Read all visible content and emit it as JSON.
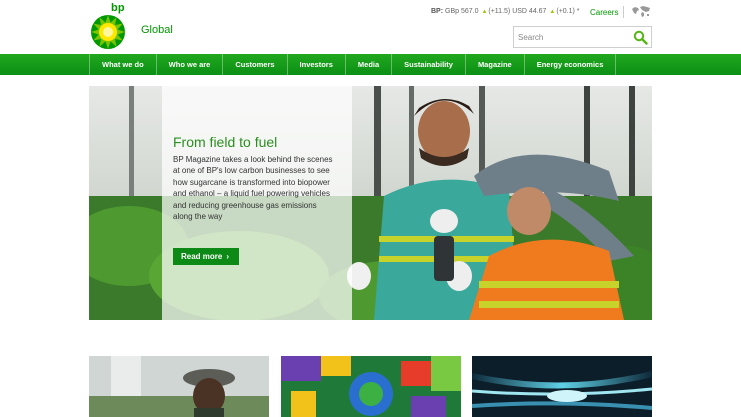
{
  "brand": {
    "name": "bp",
    "region": "Global"
  },
  "ticker": {
    "label": "BP:",
    "gbp": "GBp 567.0",
    "gbp_change": "(+11.5)",
    "usd": "USD 44.67",
    "usd_change": "(+0.1)",
    "note": "*"
  },
  "header_links": {
    "careers": "Careers"
  },
  "search": {
    "placeholder": "Search"
  },
  "nav": {
    "items": [
      "What we do",
      "Who we are",
      "Customers",
      "Investors",
      "Media",
      "Sustainability",
      "Magazine",
      "Energy economics"
    ]
  },
  "hero": {
    "title": "From field to fuel",
    "body": "BP Magazine takes a look behind the scenes at one of BP's low carbon businesses to see how sugarcane is transformed into biopower and ethanol – a liquid fuel powering vehicles and reducing greenhouse gas emissions along the way",
    "cta": "Read more"
  },
  "icons": {
    "logo": "bp-helios-logo-icon",
    "globe": "globe-icon",
    "search": "search-icon",
    "chevron": "chevron-right-icon",
    "ticker_up": "arrow-up-icon"
  },
  "colors": {
    "brand_green": "#009900",
    "nav_green": "#0b8f16",
    "ticker_up": "#99cc00",
    "helios_yellow": "#ffe800"
  }
}
